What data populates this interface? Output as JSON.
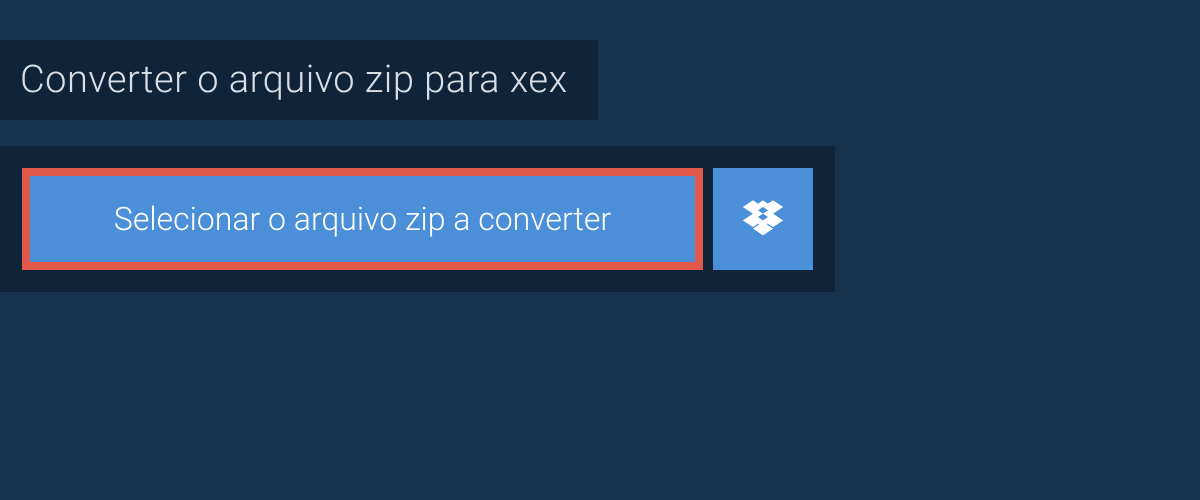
{
  "header": {
    "title": "Converter o arquivo zip para xex"
  },
  "converter": {
    "select_button_label": "Selecionar o arquivo zip a converter",
    "dropbox_icon_name": "dropbox-icon"
  },
  "colors": {
    "background": "#16324c",
    "panel": "#0f2438",
    "button": "#4a8fd7",
    "highlight_border": "#e1594a"
  }
}
